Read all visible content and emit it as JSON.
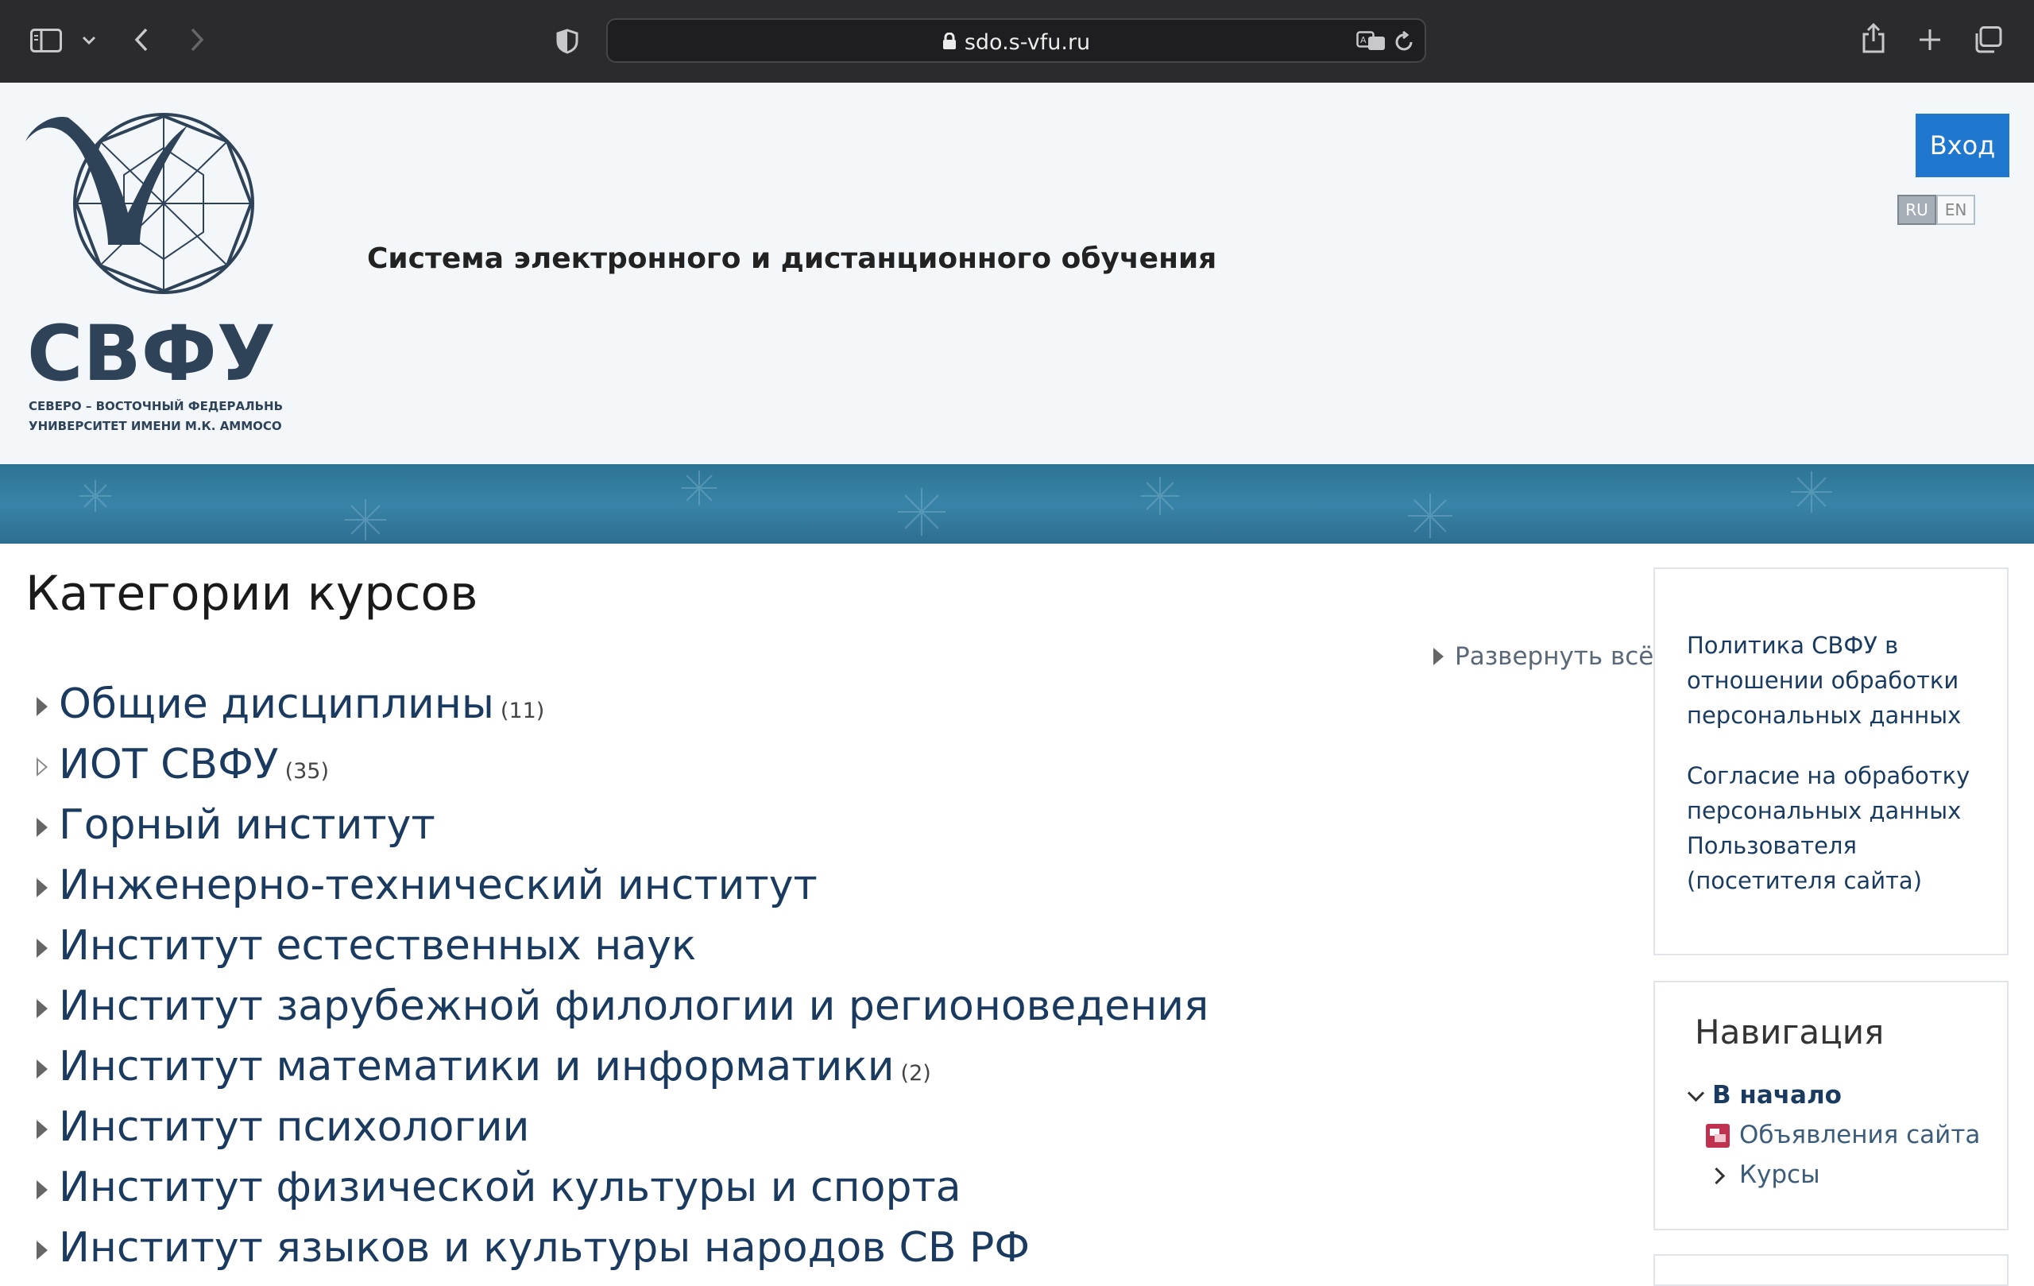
{
  "browser": {
    "url": "sdo.s-vfu.ru"
  },
  "header": {
    "logo_text": "СВФУ",
    "logo_subtitle_line1": "СЕВЕРО – ВОСТОЧНЫЙ ФЕДЕРАЛЬНЫЙ",
    "logo_subtitle_line2": "УНИВЕРСИТЕТ ИМЕНИ М.К. АММОСОВА",
    "site_title": "Система электронного и дистанционного обучения",
    "login_label": "Вход",
    "languages": [
      {
        "code": "RU",
        "active": true
      },
      {
        "code": "EN",
        "active": false
      }
    ]
  },
  "main": {
    "heading": "Категории курсов",
    "expand_all": "Развернуть всё",
    "categories": [
      {
        "name": "Общие дисциплины",
        "count": "(11)"
      },
      {
        "name": "ИОТ СВФУ",
        "count": "(35)"
      },
      {
        "name": "Горный институт",
        "count": ""
      },
      {
        "name": "Инженерно-технический институт",
        "count": ""
      },
      {
        "name": "Институт естественных наук",
        "count": ""
      },
      {
        "name": "Институт зарубежной филологии и регионоведения",
        "count": ""
      },
      {
        "name": "Институт математики и информатики",
        "count": "(2)"
      },
      {
        "name": "Институт психологии",
        "count": ""
      },
      {
        "name": "Институт физической культуры и спорта",
        "count": ""
      },
      {
        "name": "Институт языков и культуры народов СВ РФ",
        "count": ""
      }
    ]
  },
  "sidebar": {
    "policy_link": "Политика СВФУ в отношении обработки персональных данных",
    "consent_link": "Согласие на обработку персональных данных Пользователя (посетителя сайта)",
    "navigation": {
      "title": "Навигация",
      "home": "В начало",
      "items": [
        {
          "label": "Объявления сайта",
          "icon": "forum-icon"
        },
        {
          "label": "Курсы",
          "icon": "chevron-right-icon"
        }
      ]
    }
  },
  "colors": {
    "chrome_bg": "#2b2a2d",
    "header_bg": "#f4f7fa",
    "login_button": "#1f77d0",
    "link": "#1a3b5f",
    "banner": "#2d7495"
  }
}
